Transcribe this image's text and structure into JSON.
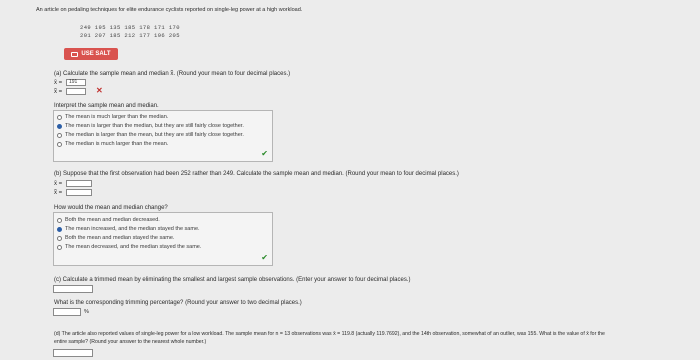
{
  "intro": "An article on pedaling techniques for elite endurance cyclists reported on single-leg power at a high workload.",
  "data_rows": [
    "249  195  135  185  178  171  170",
    "201  207  185  212  177  196  205"
  ],
  "salt_label": "USE SALT",
  "part_a": {
    "prompt": "(a) Calculate the sample mean and median x̃. (Round your mean to four decimal places.)",
    "mean_label": "x̄ =",
    "mean_value": "191",
    "median_label": "x̃ =",
    "wrong_mark": "✕"
  },
  "interpret": {
    "heading": "Interpret the sample mean and median.",
    "options": [
      "The mean is much larger than the median.",
      "The mean is larger than the median, but they are still fairly close together.",
      "The median is larger than the mean, but they are still fairly close together.",
      "The median is much larger than the mean."
    ],
    "selected": 1,
    "check": "✔"
  },
  "part_b": {
    "prompt": "(b) Suppose that the first observation had been 252 rather than 249. Calculate the sample mean and median. (Round your mean to four decimal places.)",
    "mean_label": "x̄ =",
    "median_label": "x̃ ="
  },
  "change": {
    "heading": "How would the mean and median change?",
    "options": [
      "Both the mean and median decreased.",
      "The mean increased, and the median stayed the same.",
      "Both the mean and median stayed the same.",
      "The mean decreased, and the median stayed the same."
    ],
    "selected": 1,
    "check": "✔"
  },
  "part_c": {
    "prompt": "(c) Calculate a trimmed mean by eliminating the smallest and largest sample observations. (Enter your answer to four decimal places.)",
    "trim_q": "What is the corresponding trimming percentage? (Round your answer to two decimal places.)",
    "percent_unit": "%"
  },
  "part_d": {
    "prompt": "(d) The article also reported values of single-leg power for a low workload. The sample mean for n = 13 observations was x̄ = 119.8 (actually 119.7692), and the 14th observation, somewhat of an outlier, was 155. What is the value of x̄ for the",
    "prompt2": "entire sample? (Round your answer to the nearest whole number.)"
  }
}
